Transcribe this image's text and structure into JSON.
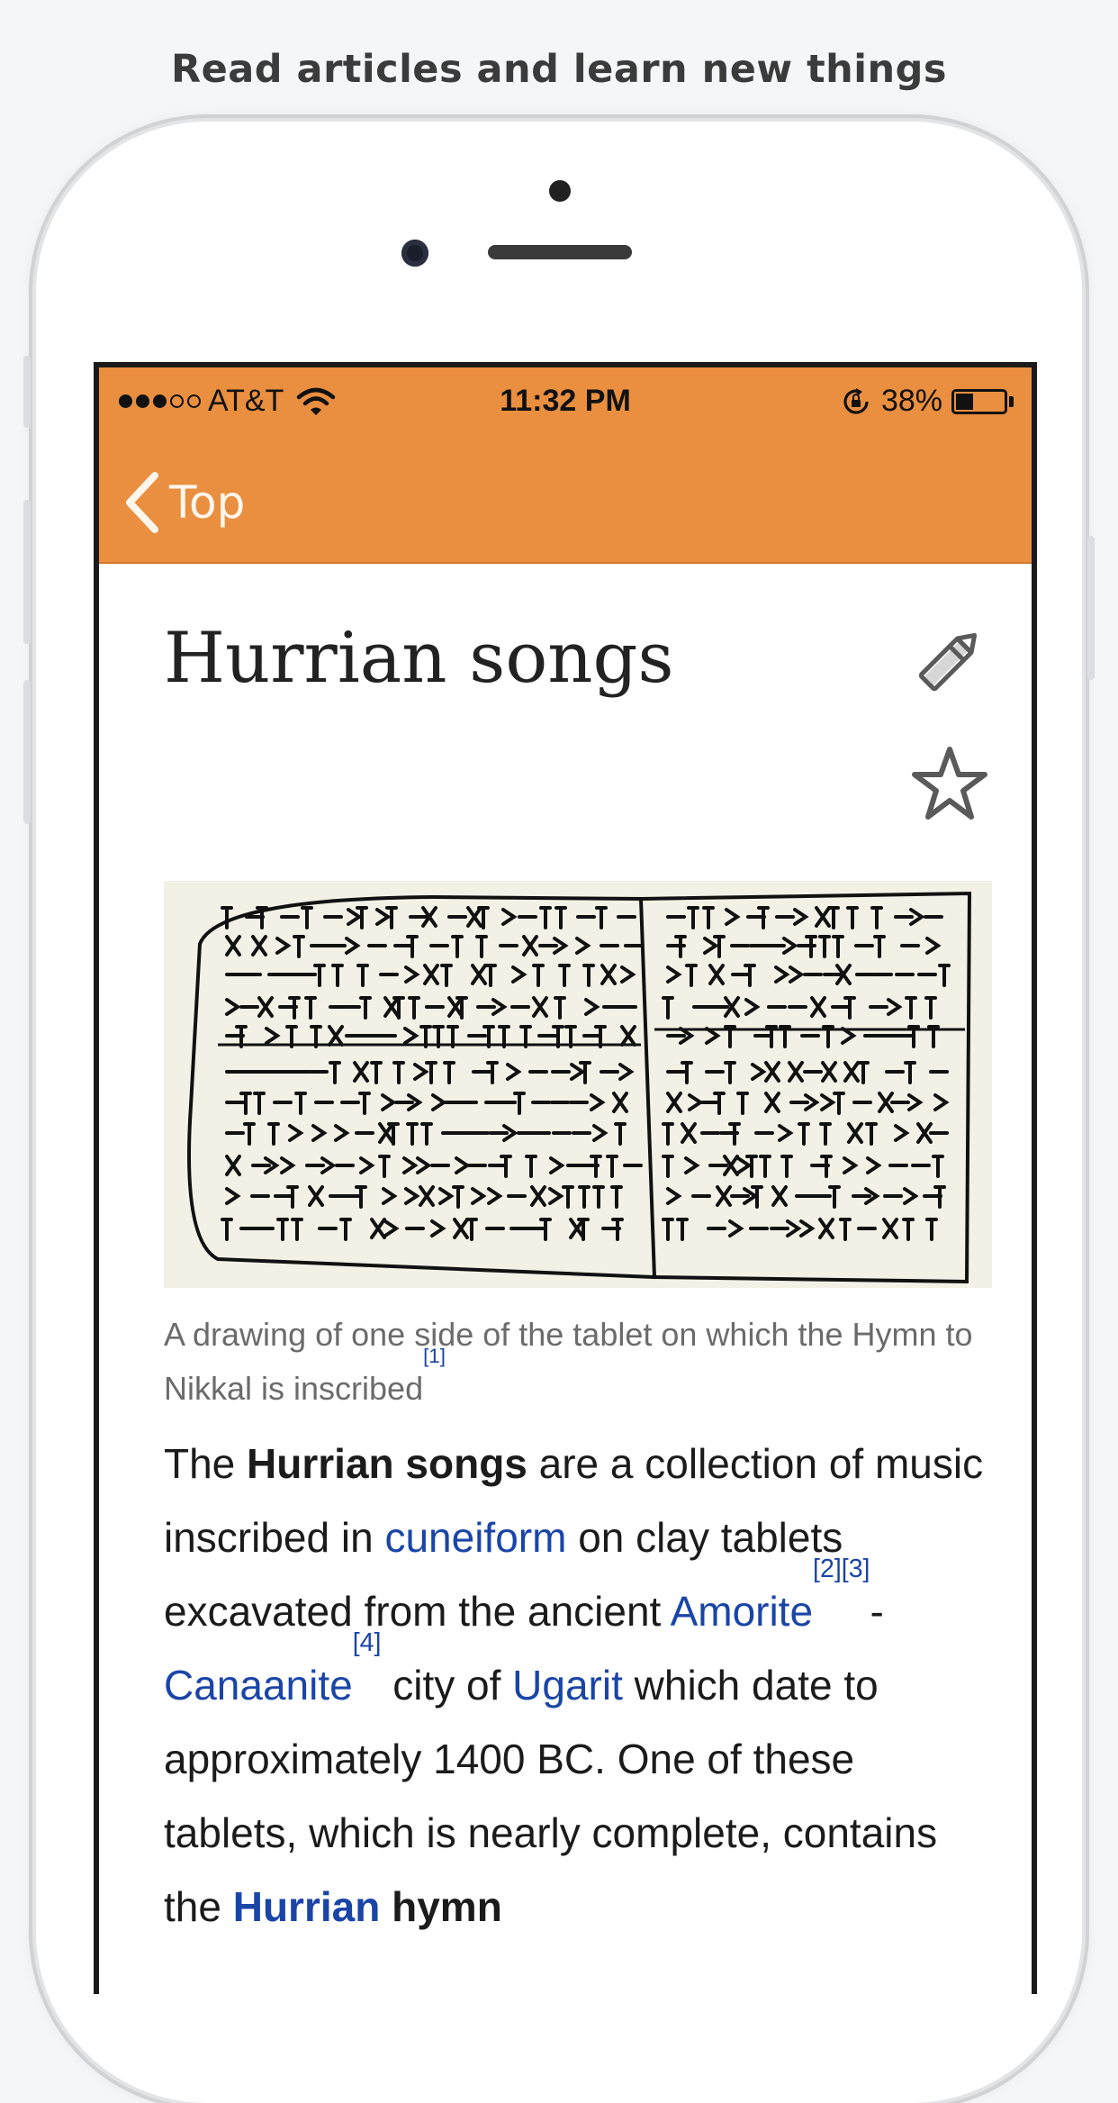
{
  "promo": {
    "headline": "Read articles and learn new things"
  },
  "status_bar": {
    "carrier": "AT&T",
    "time": "11:32 PM",
    "battery_percent": "38%",
    "battery_level": 0.38,
    "signal_filled": 3,
    "signal_total": 5
  },
  "nav": {
    "back_label": "Top",
    "accent": "#e98f3f"
  },
  "article": {
    "title": "Hurrian songs",
    "caption": {
      "text": "A drawing of one side of the tablet on which the Hymn to Nikkal is inscribed",
      "ref": "[1]"
    },
    "intro": {
      "t1": "The ",
      "b1": "Hurrian songs",
      "t2": " are a collection of music inscribed in ",
      "l1": "cuneiform",
      "t3": " on clay tablets excavated from the ancient ",
      "l2": "Amorite",
      "r2": "[2]",
      "r3": "[3]",
      "t4": "-",
      "l3": "Canaanite",
      "r4": "[4]",
      "t5": " city of ",
      "l4": "Ugarit",
      "t6": " which date to approximately 1400 BC. One of these tablets, which is nearly complete, contains the ",
      "l5": "Hurrian",
      "t7": " ",
      "b2": "hymn"
    }
  },
  "icons": {
    "back": "chevron-left-icon",
    "edit": "pencil-icon",
    "save": "star-icon",
    "wifi": "wifi-icon",
    "rotation_lock": "rotation-lock-icon"
  },
  "colors": {
    "link": "#1a45a8",
    "nav_bar": "#e98f3f"
  }
}
